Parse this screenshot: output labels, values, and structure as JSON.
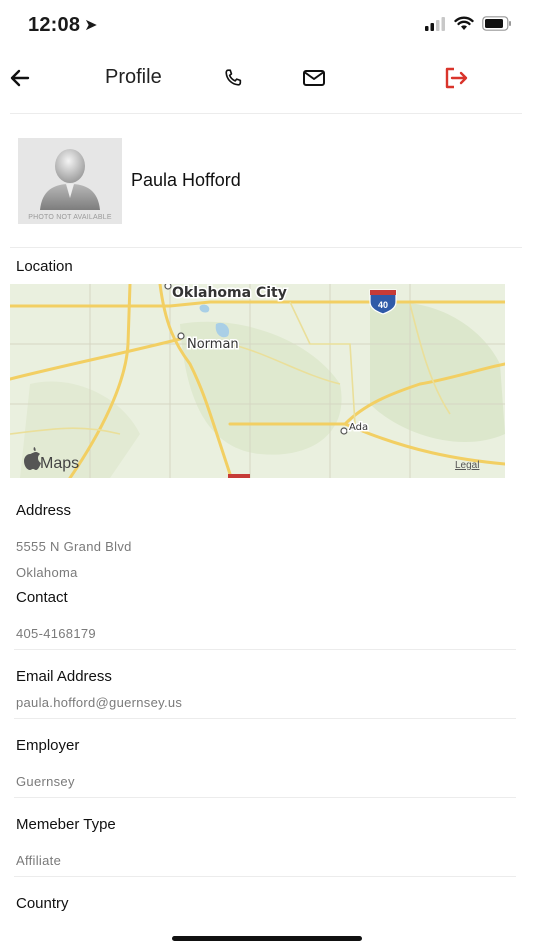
{
  "status_bar": {
    "time": "12:08"
  },
  "nav": {
    "title": "Profile",
    "icons": [
      "back-arrow-icon",
      "phone-icon",
      "mail-icon",
      "logout-icon"
    ],
    "accent_color": "#d9342b"
  },
  "profile": {
    "name": "Paula Hofford",
    "photo_placeholder_text": "PHOTO NOT AVAILABLE"
  },
  "location": {
    "label": "Location",
    "map": {
      "places": [
        "Oklahoma City",
        "Norman",
        "Ada"
      ],
      "highway_shield": "40",
      "brand": "Maps",
      "legal": "Legal"
    }
  },
  "address": {
    "label": "Address",
    "line1": "5555 N Grand Blvd",
    "line2": "Oklahoma"
  },
  "contact": {
    "label": "Contact",
    "phone": "405-4168179"
  },
  "email": {
    "label": "Email Address",
    "value": "paula.hofford@guernsey.us"
  },
  "employer": {
    "label": "Employer",
    "value": "Guernsey"
  },
  "member_type": {
    "label": "Memeber Type",
    "value": "Affiliate"
  },
  "country": {
    "label": "Country"
  }
}
